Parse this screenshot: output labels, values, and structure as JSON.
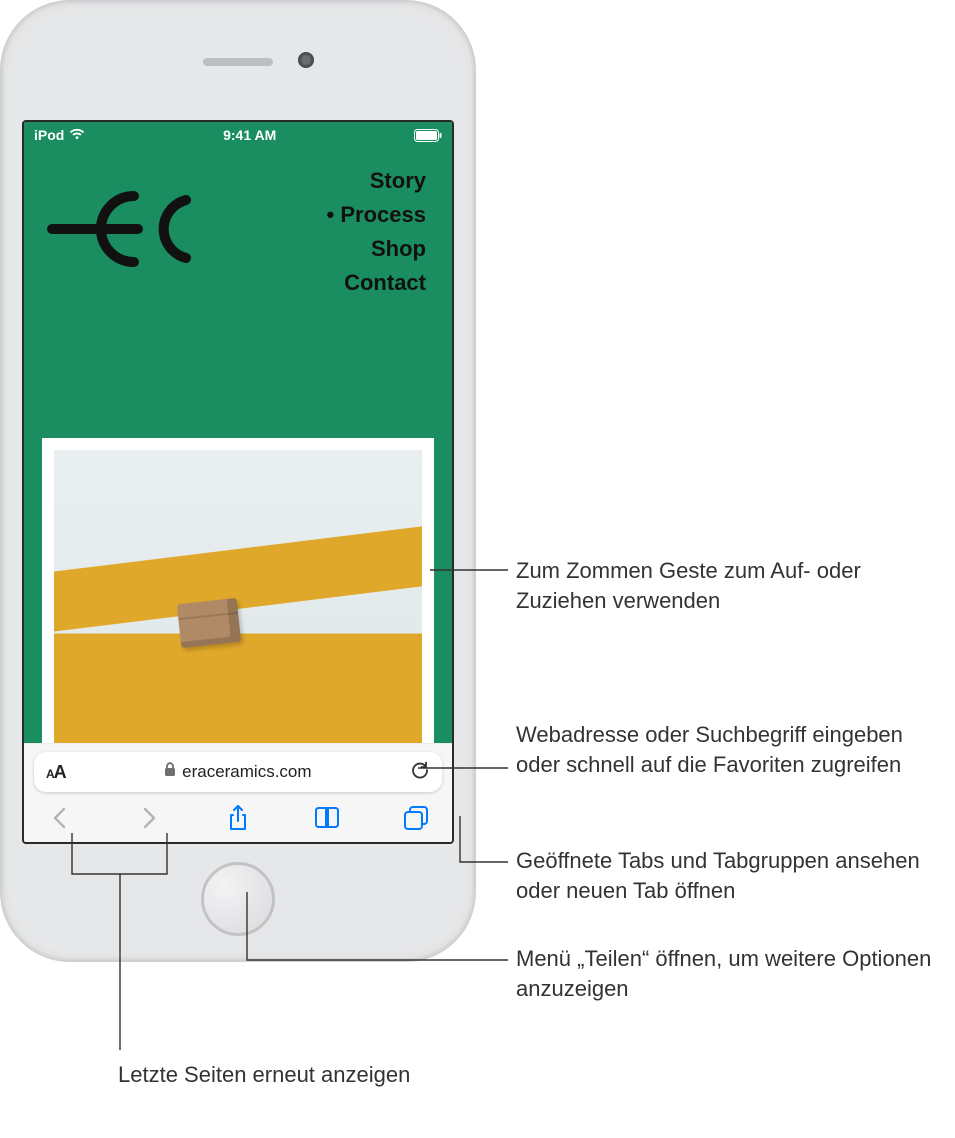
{
  "status": {
    "carrier": "iPod",
    "time": "9:41 AM"
  },
  "site": {
    "nav": {
      "story": "Story",
      "process": "Process",
      "shop": "Shop",
      "contact": "Contact"
    }
  },
  "address": {
    "url": "eraceramics.com"
  },
  "callouts": {
    "zoom": "Zum Zommen Geste zum Auf- oder Zuziehen verwenden",
    "address": "Webadresse oder Suchbegriff eingeben oder schnell auf die Favoriten zugreifen",
    "tabs": "Geöffnete Tabs und Tabgruppen ansehen oder neuen Tab öffnen",
    "share": "Menü „Teilen“ öffnen, um weitere Optionen anzuzeigen",
    "history": "Letzte Seiten erneut anzeigen"
  }
}
